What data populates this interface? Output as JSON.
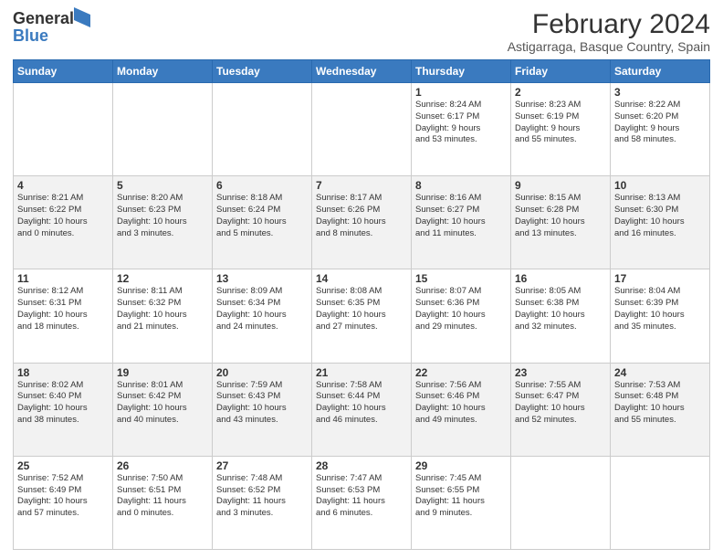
{
  "header": {
    "logo_general": "General",
    "logo_blue": "Blue",
    "title": "February 2024",
    "subtitle": "Astigarraga, Basque Country, Spain"
  },
  "weekdays": [
    "Sunday",
    "Monday",
    "Tuesday",
    "Wednesday",
    "Thursday",
    "Friday",
    "Saturday"
  ],
  "weeks": [
    [
      {
        "day": "",
        "info": ""
      },
      {
        "day": "",
        "info": ""
      },
      {
        "day": "",
        "info": ""
      },
      {
        "day": "",
        "info": ""
      },
      {
        "day": "1",
        "info": "Sunrise: 8:24 AM\nSunset: 6:17 PM\nDaylight: 9 hours\nand 53 minutes."
      },
      {
        "day": "2",
        "info": "Sunrise: 8:23 AM\nSunset: 6:19 PM\nDaylight: 9 hours\nand 55 minutes."
      },
      {
        "day": "3",
        "info": "Sunrise: 8:22 AM\nSunset: 6:20 PM\nDaylight: 9 hours\nand 58 minutes."
      }
    ],
    [
      {
        "day": "4",
        "info": "Sunrise: 8:21 AM\nSunset: 6:22 PM\nDaylight: 10 hours\nand 0 minutes."
      },
      {
        "day": "5",
        "info": "Sunrise: 8:20 AM\nSunset: 6:23 PM\nDaylight: 10 hours\nand 3 minutes."
      },
      {
        "day": "6",
        "info": "Sunrise: 8:18 AM\nSunset: 6:24 PM\nDaylight: 10 hours\nand 5 minutes."
      },
      {
        "day": "7",
        "info": "Sunrise: 8:17 AM\nSunset: 6:26 PM\nDaylight: 10 hours\nand 8 minutes."
      },
      {
        "day": "8",
        "info": "Sunrise: 8:16 AM\nSunset: 6:27 PM\nDaylight: 10 hours\nand 11 minutes."
      },
      {
        "day": "9",
        "info": "Sunrise: 8:15 AM\nSunset: 6:28 PM\nDaylight: 10 hours\nand 13 minutes."
      },
      {
        "day": "10",
        "info": "Sunrise: 8:13 AM\nSunset: 6:30 PM\nDaylight: 10 hours\nand 16 minutes."
      }
    ],
    [
      {
        "day": "11",
        "info": "Sunrise: 8:12 AM\nSunset: 6:31 PM\nDaylight: 10 hours\nand 18 minutes."
      },
      {
        "day": "12",
        "info": "Sunrise: 8:11 AM\nSunset: 6:32 PM\nDaylight: 10 hours\nand 21 minutes."
      },
      {
        "day": "13",
        "info": "Sunrise: 8:09 AM\nSunset: 6:34 PM\nDaylight: 10 hours\nand 24 minutes."
      },
      {
        "day": "14",
        "info": "Sunrise: 8:08 AM\nSunset: 6:35 PM\nDaylight: 10 hours\nand 27 minutes."
      },
      {
        "day": "15",
        "info": "Sunrise: 8:07 AM\nSunset: 6:36 PM\nDaylight: 10 hours\nand 29 minutes."
      },
      {
        "day": "16",
        "info": "Sunrise: 8:05 AM\nSunset: 6:38 PM\nDaylight: 10 hours\nand 32 minutes."
      },
      {
        "day": "17",
        "info": "Sunrise: 8:04 AM\nSunset: 6:39 PM\nDaylight: 10 hours\nand 35 minutes."
      }
    ],
    [
      {
        "day": "18",
        "info": "Sunrise: 8:02 AM\nSunset: 6:40 PM\nDaylight: 10 hours\nand 38 minutes."
      },
      {
        "day": "19",
        "info": "Sunrise: 8:01 AM\nSunset: 6:42 PM\nDaylight: 10 hours\nand 40 minutes."
      },
      {
        "day": "20",
        "info": "Sunrise: 7:59 AM\nSunset: 6:43 PM\nDaylight: 10 hours\nand 43 minutes."
      },
      {
        "day": "21",
        "info": "Sunrise: 7:58 AM\nSunset: 6:44 PM\nDaylight: 10 hours\nand 46 minutes."
      },
      {
        "day": "22",
        "info": "Sunrise: 7:56 AM\nSunset: 6:46 PM\nDaylight: 10 hours\nand 49 minutes."
      },
      {
        "day": "23",
        "info": "Sunrise: 7:55 AM\nSunset: 6:47 PM\nDaylight: 10 hours\nand 52 minutes."
      },
      {
        "day": "24",
        "info": "Sunrise: 7:53 AM\nSunset: 6:48 PM\nDaylight: 10 hours\nand 55 minutes."
      }
    ],
    [
      {
        "day": "25",
        "info": "Sunrise: 7:52 AM\nSunset: 6:49 PM\nDaylight: 10 hours\nand 57 minutes."
      },
      {
        "day": "26",
        "info": "Sunrise: 7:50 AM\nSunset: 6:51 PM\nDaylight: 11 hours\nand 0 minutes."
      },
      {
        "day": "27",
        "info": "Sunrise: 7:48 AM\nSunset: 6:52 PM\nDaylight: 11 hours\nand 3 minutes."
      },
      {
        "day": "28",
        "info": "Sunrise: 7:47 AM\nSunset: 6:53 PM\nDaylight: 11 hours\nand 6 minutes."
      },
      {
        "day": "29",
        "info": "Sunrise: 7:45 AM\nSunset: 6:55 PM\nDaylight: 11 hours\nand 9 minutes."
      },
      {
        "day": "",
        "info": ""
      },
      {
        "day": "",
        "info": ""
      }
    ]
  ]
}
